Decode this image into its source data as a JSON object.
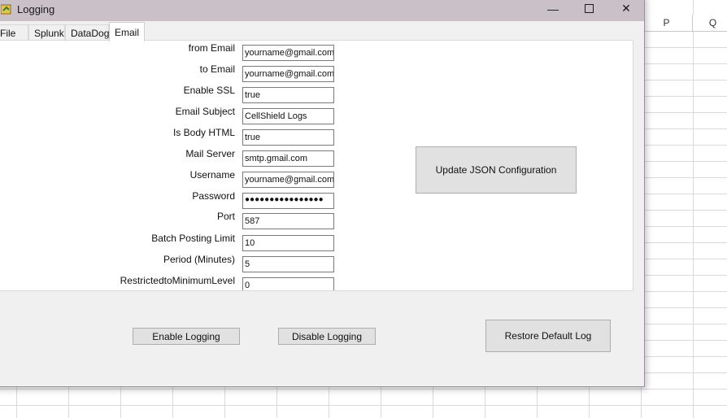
{
  "window": {
    "title": "Logging",
    "controls": {
      "minimize": "—",
      "close": "✕"
    }
  },
  "tabs": [
    "File",
    "Splunk",
    "DataDog",
    "Email"
  ],
  "active_tab": "Email",
  "email_form": [
    {
      "label": "from Email",
      "value": "yourname@gmail.com"
    },
    {
      "label": "to Email",
      "value": "yourname@gmail.com"
    },
    {
      "label": "Enable SSL",
      "value": "true"
    },
    {
      "label": "Email Subject",
      "value": "CellShield Logs"
    },
    {
      "label": "Is Body HTML",
      "value": "true"
    },
    {
      "label": "Mail Server",
      "value": "smtp.gmail.com"
    },
    {
      "label": "Username",
      "value": "yourname@gmail.com"
    },
    {
      "label": "Password",
      "value": "●●●●●●●●●●●●●●●●"
    },
    {
      "label": "Port",
      "value": "587"
    },
    {
      "label": "Batch Posting Limit",
      "value": "10"
    },
    {
      "label": "Period (Minutes)",
      "value": "5"
    },
    {
      "label": "RestrictedtoMinimumLevel",
      "value": "0"
    }
  ],
  "buttons": {
    "update_json": "Update JSON Configuration",
    "enable_logging": "Enable Logging",
    "disable_logging": "Disable Logging",
    "restore_default": "Restore Default Log"
  },
  "spreadsheet": {
    "column_headers": [
      "P",
      "Q"
    ]
  }
}
